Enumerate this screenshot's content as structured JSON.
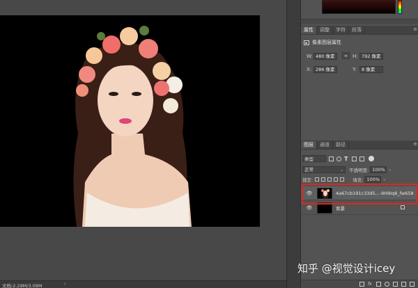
{
  "properties_panel": {
    "tabs": [
      "属性",
      "调整",
      "字符",
      "段落"
    ],
    "header": "像素图层属性",
    "fields": {
      "w_label": "W:",
      "w_value": "480 像素",
      "h_label": "H:",
      "h_value": "792 像素",
      "x_label": "X:",
      "x_value": "286 像素",
      "y_label": "Y:",
      "y_value": "8 像素"
    }
  },
  "layers_panel": {
    "tabs": [
      "图层",
      "通道",
      "路径"
    ],
    "filter_type": "类型",
    "blend_mode": "正常",
    "opacity_label": "不透明度:",
    "opacity_value": "100%",
    "lock_label": "锁定:",
    "fill_label": "填充:",
    "fill_value": "100%",
    "layers": [
      {
        "name": "4a67cb191c33d5...-9H9Iq6_fw658",
        "selected": true,
        "visible": true
      },
      {
        "name": "背景",
        "selected": false,
        "visible": true,
        "locked": true
      }
    ]
  },
  "status_bar": {
    "doc_info": "文档:2.29M/3.09M"
  },
  "watermark": "知乎 @视觉设计icey",
  "colors": {
    "highlight": "#e0261e",
    "panel_bg": "#535353",
    "canvas_bg": "#000000"
  },
  "icons": [
    "image-icon",
    "link-icon",
    "eye-icon",
    "lock-icon",
    "fx-icon",
    "mask-icon",
    "folder-icon",
    "new-layer-icon",
    "trash-icon"
  ]
}
